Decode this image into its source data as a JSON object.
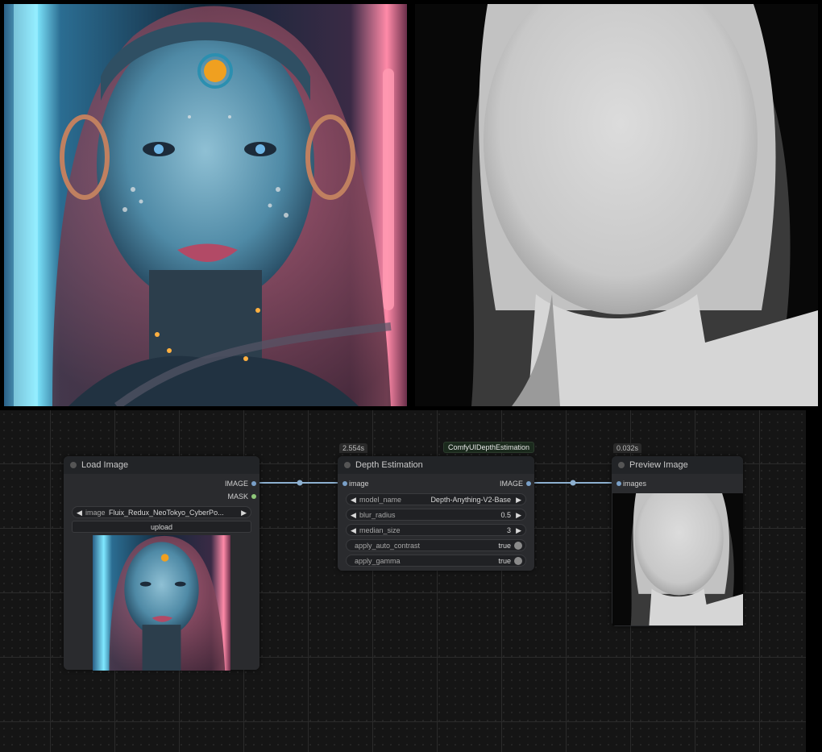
{
  "colors": {
    "image_pin": "#7aa0c8",
    "mask_pin": "#8fc87a",
    "link": "#8db0d0",
    "canvas": "#151515"
  },
  "hero_left": {
    "icon": "cyborg-portrait-image"
  },
  "hero_right": {
    "icon": "depth-map-image"
  },
  "nodes": {
    "load_image": {
      "title": "Load Image",
      "outputs": [
        "IMAGE",
        "MASK"
      ],
      "image_label": "image",
      "image_value": "Fluix_Redux_NeoTokyo_CyberPo...",
      "upload_label": "upload"
    },
    "depth": {
      "time": "2.554s",
      "badge": "ComfyUIDepthEstimation",
      "title": "Depth Estimation",
      "input": "image",
      "output": "IMAGE",
      "widgets": [
        {
          "label": "model_name",
          "value": "Depth-Anything-V2-Base"
        },
        {
          "label": "blur_radius",
          "value": "0.5"
        },
        {
          "label": "median_size",
          "value": "3"
        },
        {
          "label": "apply_auto_contrast",
          "value": "true"
        },
        {
          "label": "apply_gamma",
          "value": "true"
        }
      ]
    },
    "preview": {
      "time": "0.032s",
      "title": "Preview Image",
      "input": "images"
    }
  }
}
